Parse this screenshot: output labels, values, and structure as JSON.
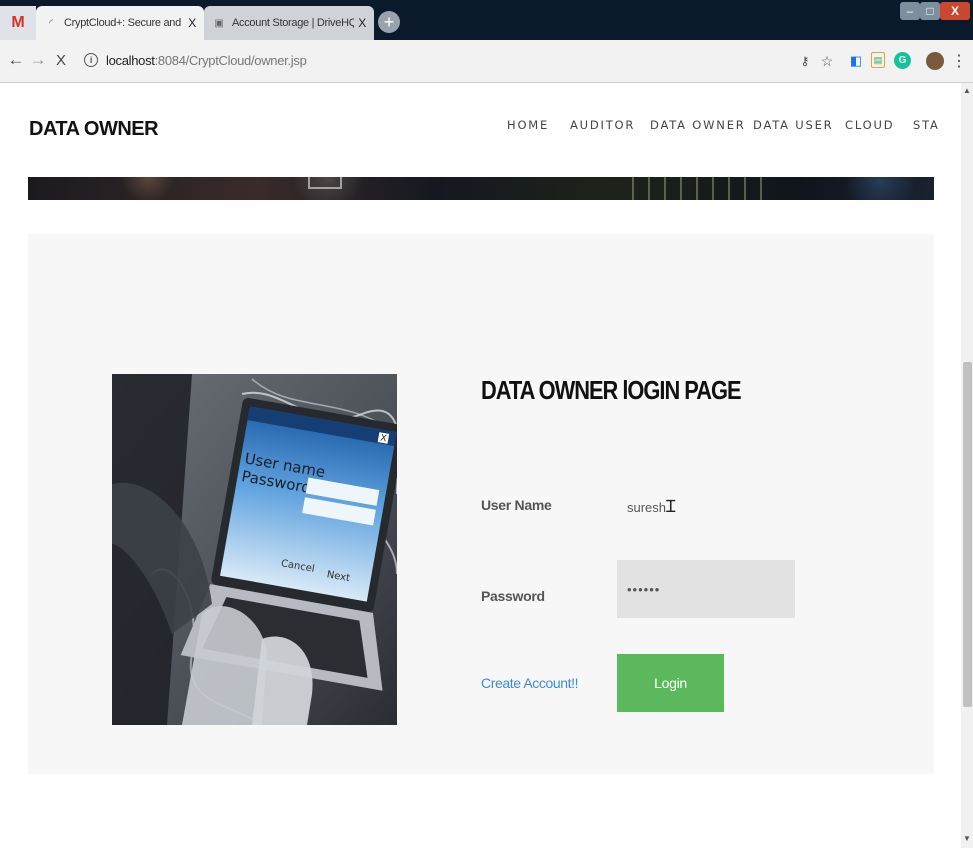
{
  "browser": {
    "tabs": [
      {
        "favicon": "gmail-icon",
        "label": "M"
      },
      {
        "title": "CryptCloud+: Secure and Expres",
        "close": "X",
        "favicon": "loading-icon"
      },
      {
        "title": "Account Storage | DriveHQ",
        "close": "X",
        "favicon": "page-icon"
      }
    ],
    "new_tab": "+",
    "window": {
      "minimize": "–",
      "maximize": "□",
      "close": "X"
    },
    "nav": {
      "back": "←",
      "forward": "→",
      "stop": "X"
    },
    "url": {
      "host": "localhost",
      "rest": ":8084/CryptCloud/owner.jsp"
    },
    "icons": {
      "key": "key-icon",
      "star": "star-icon",
      "menu": "kebab-menu-icon"
    }
  },
  "site": {
    "logo": "DATA OWNER",
    "nav": [
      "HOME",
      "AUDITOR",
      "DATA OWNER",
      "DATA USER",
      "CLOUD",
      "STA"
    ]
  },
  "login": {
    "heading": "DATA OWNER lOGIN PAGE",
    "username_label": "User Name",
    "username_value": "suresh",
    "password_label": "Password",
    "password_value": "••••••",
    "create_account": "Create Account!!",
    "login_button": "Login"
  },
  "illustration": {
    "screen_user": "User name",
    "screen_pass": "Password",
    "cancel": "Cancel",
    "next": "Next",
    "close": "X"
  },
  "colors": {
    "login_button": "#5cb85c",
    "link": "#3b8cd9",
    "panel_bg": "#f7f7f7"
  }
}
